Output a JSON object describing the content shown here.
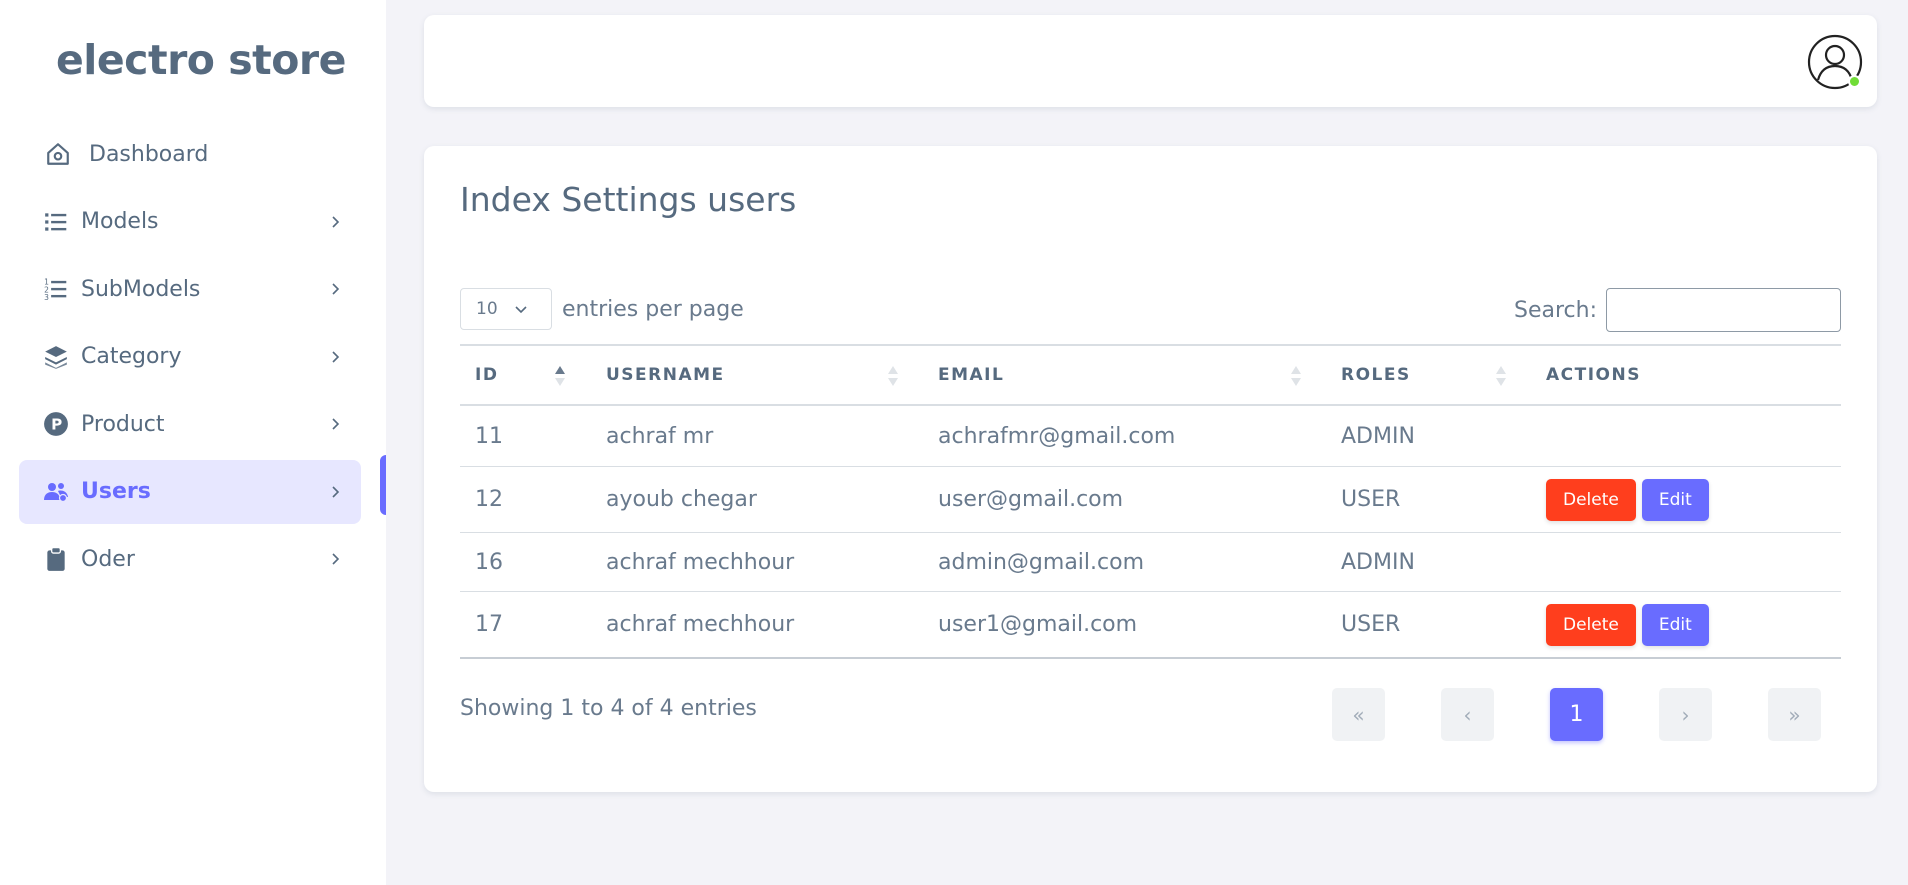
{
  "brand": "electro store",
  "sidebar": {
    "items": [
      {
        "label": "Dashboard",
        "icon": "home-icon",
        "has_chevron": false,
        "active": false
      },
      {
        "label": "Models",
        "icon": "list-icon",
        "has_chevron": true,
        "active": false
      },
      {
        "label": "SubModels",
        "icon": "list-numbered-icon",
        "has_chevron": true,
        "active": false
      },
      {
        "label": "Category",
        "icon": "layers-icon",
        "has_chevron": true,
        "active": false
      },
      {
        "label": "Product",
        "icon": "product-p-icon",
        "has_chevron": true,
        "active": false
      },
      {
        "label": "Users",
        "icon": "users-icon",
        "has_chevron": true,
        "active": true
      },
      {
        "label": "Oder",
        "icon": "clipboard-icon",
        "has_chevron": true,
        "active": false
      }
    ]
  },
  "topbar": {
    "avatar_icon": "user-avatar-icon",
    "online_status_color": "#71dd37"
  },
  "main": {
    "title": "Index Settings users",
    "per_page": {
      "value": "10",
      "label": "entries per page"
    },
    "search": {
      "label": "Search:",
      "value": ""
    },
    "table": {
      "columns": [
        "ID",
        "USERNAME",
        "EMAIL",
        "ROLES",
        "ACTIONS"
      ],
      "rows": [
        {
          "id": "11",
          "username": "achraf mr",
          "email": "achrafmr@gmail.com",
          "roles": "ADMIN",
          "actions": []
        },
        {
          "id": "12",
          "username": "ayoub chegar",
          "email": "user@gmail.com",
          "roles": "USER",
          "actions": [
            "Delete",
            "Edit"
          ]
        },
        {
          "id": "16",
          "username": "achraf mechhour",
          "email": "admin@gmail.com",
          "roles": "ADMIN",
          "actions": []
        },
        {
          "id": "17",
          "username": "achraf mechhour",
          "email": "user1@gmail.com",
          "roles": "USER",
          "actions": [
            "Delete",
            "Edit"
          ]
        }
      ]
    },
    "info": "Showing 1 to 4 of 4 entries",
    "pagination": {
      "first": "«",
      "prev": "‹",
      "current": "1",
      "next": "›",
      "last": "»"
    }
  },
  "colors": {
    "accent": "#696cff",
    "danger": "#ff3e1d",
    "text": "#697a8d",
    "heading": "#566a7f"
  }
}
